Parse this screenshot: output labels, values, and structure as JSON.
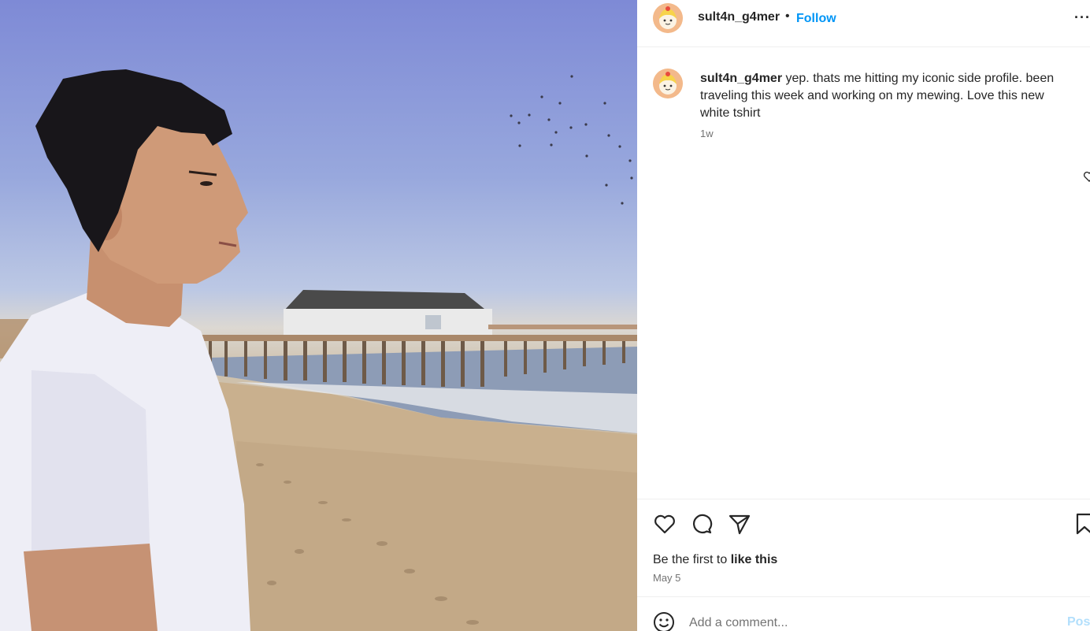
{
  "post": {
    "username": "sult4n_g4mer",
    "follow_label": "Follow",
    "separator": "•",
    "more_label": "···"
  },
  "caption": {
    "username": "sult4n_g4mer",
    "text": "yep. thats me hitting my iconic side profile. been traveling this week and working on my mewing. Love this new white tshirt",
    "time": "1w"
  },
  "engagement": {
    "likes_prefix": "Be the first to ",
    "likes_action": "like this",
    "date": "May 5"
  },
  "comment": {
    "placeholder": "Add a comment...",
    "post_label": "Post"
  },
  "icons": {
    "like": "heart-icon",
    "comment": "comment-bubble-icon",
    "share": "paper-plane-icon",
    "save": "bookmark-icon",
    "emoji": "smiley-icon",
    "more": "ellipsis-icon"
  },
  "colors": {
    "accent": "#0095f6",
    "text": "#262626",
    "muted": "#737373",
    "post_disabled": "#b2dffc"
  }
}
